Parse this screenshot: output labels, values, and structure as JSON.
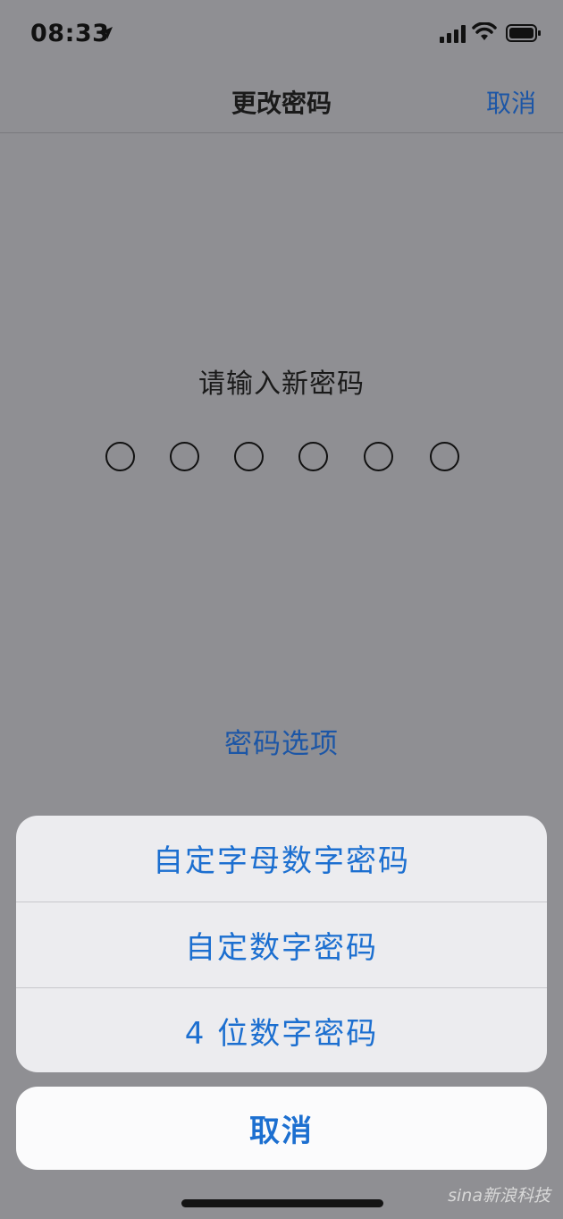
{
  "status_bar": {
    "time": "08:33",
    "icons": [
      "location-arrow-icon",
      "cellular-signal-icon",
      "wifi-icon",
      "battery-icon"
    ]
  },
  "nav": {
    "title": "更改密码",
    "cancel_label": "取消"
  },
  "passcode": {
    "prompt": "请输入新密码",
    "digit_count": 6
  },
  "options_link": "密码选项",
  "action_sheet": {
    "items": [
      {
        "label": "自定字母数字密码"
      },
      {
        "label": "自定数字密码"
      },
      {
        "label": "4 位数字密码"
      }
    ],
    "cancel_label": "取消"
  },
  "watermark": "sina新浪科技",
  "colors": {
    "accent": "#1c6fd0",
    "dim_overlay": "#8f8f93",
    "sheet_bg": "#ececef"
  }
}
